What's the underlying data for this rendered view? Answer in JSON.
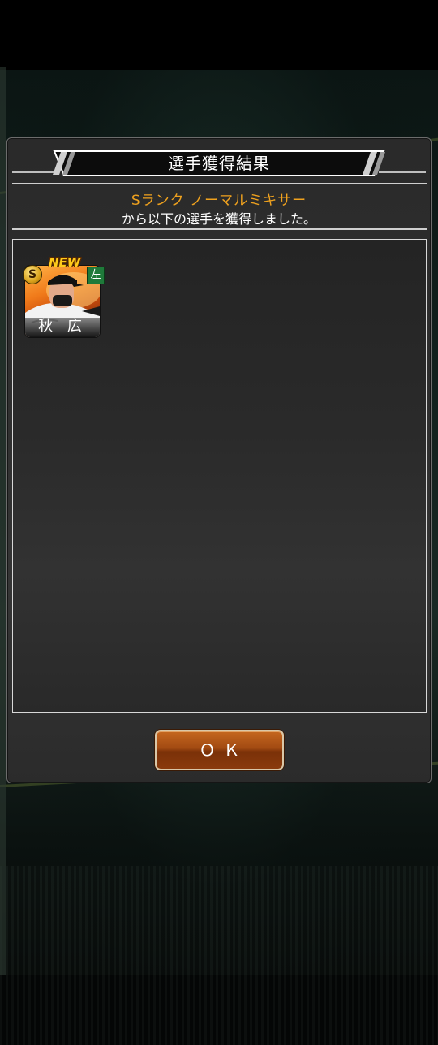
{
  "dialog": {
    "title": "選手獲得結果",
    "source_label": "Sランク ノーマルミキサー",
    "message": "から以下の選手を獲得しました。",
    "ok_label": "ＯＫ"
  },
  "players": [
    {
      "name": "秋 広",
      "rank": "S",
      "new_badge": "NEW",
      "hand": "左"
    }
  ],
  "colors": {
    "source_label": "#f0a21e",
    "ok_button": "#a24a12",
    "hand_badge": "#1f7a3a"
  }
}
